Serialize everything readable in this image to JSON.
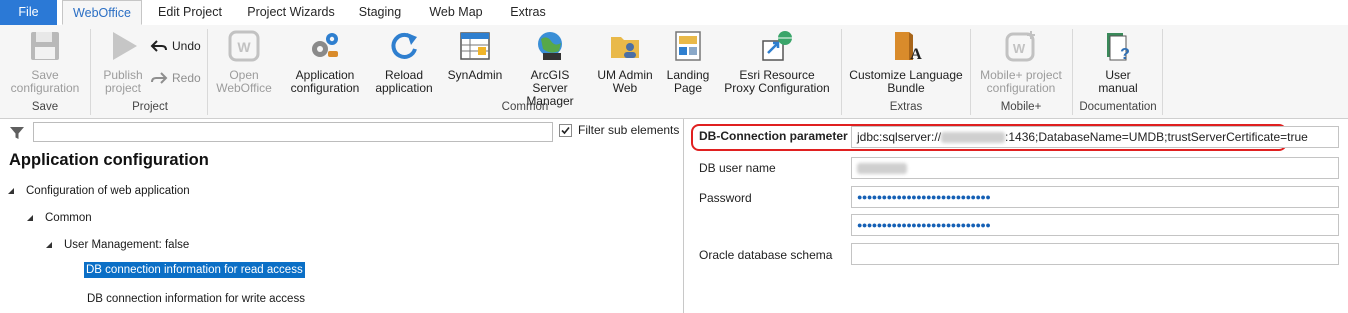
{
  "tabs": {
    "file": "File",
    "webOffice": "WebOffice",
    "editProject": "Edit Project",
    "projectWizards": "Project Wizards",
    "staging": "Staging",
    "webMap": "Web Map",
    "extras": "Extras"
  },
  "ribbon": {
    "save": {
      "line1": "Save",
      "line2": "configuration"
    },
    "publish": {
      "line1": "Publish",
      "line2": "project"
    },
    "undo": "Undo",
    "redo": "Redo",
    "openWebOffice": {
      "line1": "Open",
      "line2": "WebOffice"
    },
    "appConfig": {
      "line1": "Application",
      "line2": "configuration"
    },
    "reload": {
      "line1": "Reload",
      "line2": "application"
    },
    "synAdmin": "SynAdmin",
    "arcgisManager": {
      "line1": "ArcGIS Server",
      "line2": "Manager"
    },
    "umAdmin": {
      "line1": "UM Admin",
      "line2": "Web"
    },
    "landing": {
      "line1": "Landing",
      "line2": "Page"
    },
    "esriProxy": {
      "line1": "Esri Resource",
      "line2": "Proxy Configuration"
    },
    "customizeLang": {
      "line1": "Customize Language",
      "line2": "Bundle"
    },
    "mobileConfig": {
      "line1": "Mobile+ project",
      "line2": "configuration"
    },
    "userManual": {
      "line1": "User",
      "line2": "manual"
    },
    "groups": {
      "save": "Save",
      "project": "Project",
      "common": "Common",
      "extras": "Extras",
      "mobile": "Mobile+",
      "documentation": "Documentation"
    }
  },
  "leftPane": {
    "filterPlaceholder": "",
    "filterSubElements": "Filter sub elements",
    "filterChecked": true,
    "title": "Application configuration",
    "tree": [
      {
        "label": "Configuration of web application"
      },
      {
        "label": "Common"
      },
      {
        "label": "User Management: false"
      },
      {
        "label": "DB connection information for read access"
      },
      {
        "label": "DB connection information for write access"
      }
    ]
  },
  "rightPane": {
    "dbConnLabel": "DB-Connection parameter",
    "dbConnPrefix": "jdbc:sqlserver://",
    "dbConnSuffix": ":1436;DatabaseName=UMDB;trustServerCertificate=true",
    "dbUserLabel": "DB user name",
    "passwordLabel": "Password",
    "passwordMask": "●●●●●●●●●●●●●●●●●●●●●●●●●●●",
    "passwordConfirmMask": "●●●●●●●●●●●●●●●●●●●●●●●●●●●",
    "oracleLabel": "Oracle database schema",
    "oracleValue": ""
  },
  "colors": {
    "accent": "#2b79d6",
    "selection": "#0b6fc6",
    "highlight": "#e02020",
    "password": "#1560b5"
  }
}
